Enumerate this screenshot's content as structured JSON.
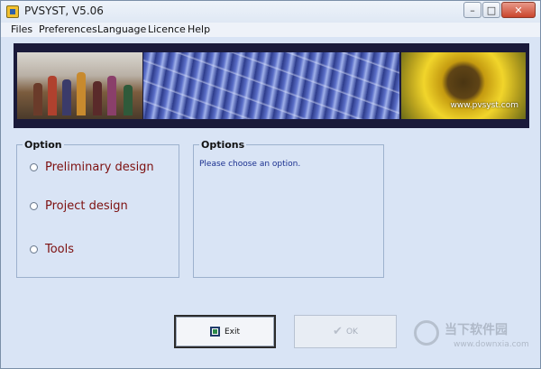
{
  "window": {
    "title": "PVSYST, V5.06"
  },
  "menu": [
    "Files",
    "Preferences",
    "Language",
    "Licence",
    "Help"
  ],
  "banner": {
    "sunflower_caption": "www.pvsyst.com"
  },
  "option_group": {
    "legend": "Option",
    "items": [
      "Preliminary design",
      "Project design",
      "Tools"
    ]
  },
  "options_panel": {
    "legend": "Options",
    "message": "Please choose an option."
  },
  "buttons": {
    "exit": "Exit",
    "ok": "OK"
  },
  "watermark": {
    "name": "当下软件园",
    "url": "www.downxia.com"
  },
  "colors": {
    "window_bg": "#d9e4f5",
    "option_text": "#7d1010",
    "message_text": "#1a2f8f"
  }
}
